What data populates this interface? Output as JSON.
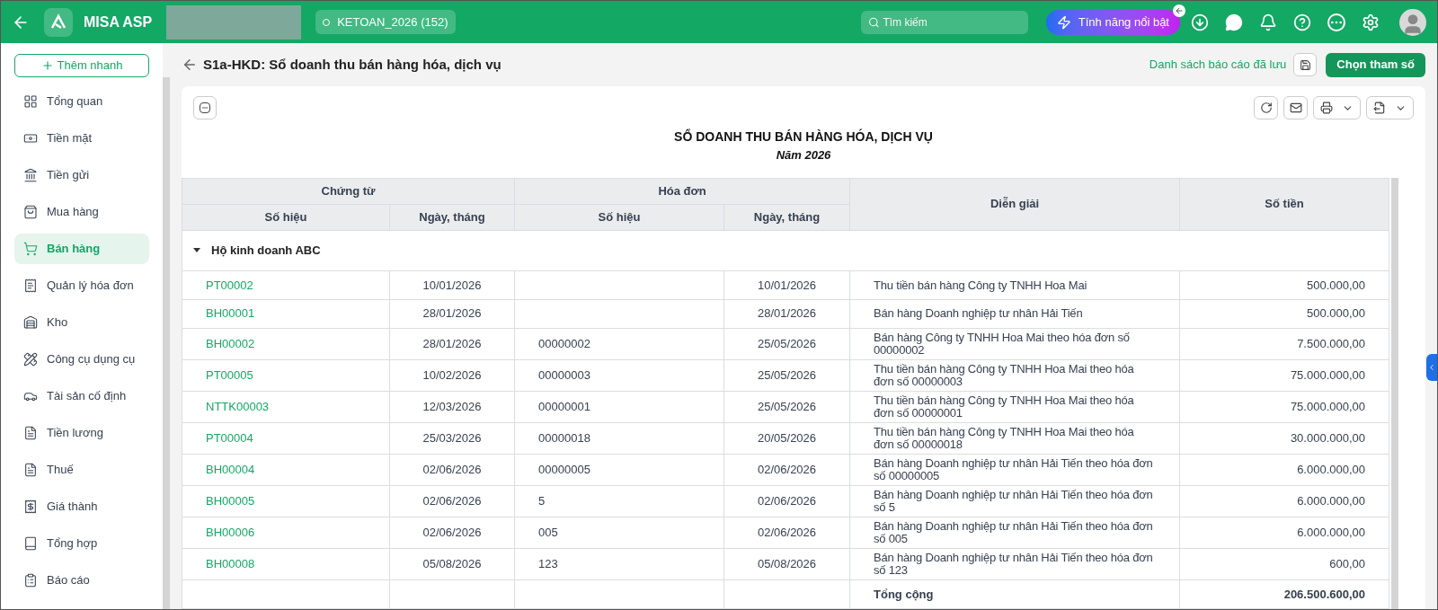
{
  "header": {
    "app_name": "MISA ASP",
    "database": "KETOAN_2026 (152)",
    "search": {
      "placeholder": "Tìm kiếm"
    },
    "featured_button": "Tính năng nổi bật"
  },
  "sidebar": {
    "quick_add": "Thêm nhanh",
    "items": [
      {
        "label": "Tổng quan",
        "selected": false
      },
      {
        "label": "Tiền mặt",
        "selected": false
      },
      {
        "label": "Tiền gửi",
        "selected": false
      },
      {
        "label": "Mua hàng",
        "selected": false
      },
      {
        "label": "Bán hàng",
        "selected": true
      },
      {
        "label": "Quản lý hóa đơn",
        "selected": false
      },
      {
        "label": "Kho",
        "selected": false
      },
      {
        "label": "Công cụ dụng cụ",
        "selected": false
      },
      {
        "label": "Tài sản cố định",
        "selected": false
      },
      {
        "label": "Tiền lương",
        "selected": false
      },
      {
        "label": "Thuế",
        "selected": false
      },
      {
        "label": "Giá thành",
        "selected": false
      },
      {
        "label": "Tổng hợp",
        "selected": false
      },
      {
        "label": "Báo cáo",
        "selected": false
      }
    ]
  },
  "page": {
    "title": "S1a-HKD: Sổ doanh thu bán hàng hóa, dịch vụ",
    "saved_reports_link": "Danh sách báo cáo đã lưu",
    "choose_params_button": "Chọn tham số"
  },
  "report": {
    "title": "SỔ DOANH THU BÁN HÀNG HÓA, DỊCH VỤ",
    "subtitle": "Năm 2026",
    "column_groups": [
      "Chứng từ",
      "Hóa đơn",
      "Diễn giải",
      "Số tiền"
    ],
    "columns": [
      "Số hiệu",
      "Ngày, tháng",
      "Số hiệu",
      "Ngày, tháng"
    ],
    "group": {
      "label": "Hộ kinh doanh ABC",
      "expanded": true
    },
    "rows": [
      {
        "voucher_no": "PT00002",
        "voucher_date": "10/01/2026",
        "invoice_date": "10/01/2026",
        "description": "Thu tiền bán hàng Công ty TNHH Hoa Mai",
        "amount": "500.000,00"
      },
      {
        "voucher_no": "BH00001",
        "voucher_date": "28/01/2026",
        "invoice_date": "28/01/2026",
        "description": "Bán hàng Doanh nghiệp tư nhân Hải Tiến",
        "amount": "500.000,00"
      },
      {
        "voucher_no": "BH00002",
        "voucher_date": "28/01/2026",
        "invoice_no": "00000002",
        "invoice_date": "25/05/2026",
        "description": "Bán hàng Công ty TNHH Hoa Mai theo hóa đơn số 00000002",
        "amount": "7.500.000,00"
      },
      {
        "voucher_no": "PT00005",
        "voucher_date": "10/02/2026",
        "invoice_no": "00000003",
        "invoice_date": "25/05/2026",
        "description": "Thu tiền bán hàng Công ty TNHH Hoa Mai theo hóa đơn số 00000003",
        "amount": "75.000.000,00"
      },
      {
        "voucher_no": "NTTK00003",
        "voucher_date": "12/03/2026",
        "invoice_no": "00000001",
        "invoice_date": "25/05/2026",
        "description": "Thu tiền bán hàng Công ty TNHH Hoa Mai theo hóa đơn số 00000001",
        "amount": "75.000.000,00"
      },
      {
        "voucher_no": "PT00004",
        "voucher_date": "25/03/2026",
        "invoice_no": "00000018",
        "invoice_date": "20/05/2026",
        "description": "Thu tiền bán hàng Công ty TNHH Hoa Mai theo hóa đơn số 00000018",
        "amount": "30.000.000,00"
      },
      {
        "voucher_no": "BH00004",
        "voucher_date": "02/06/2026",
        "invoice_no": "00000005",
        "invoice_date": "02/06/2026",
        "description": "Bán hàng Doanh nghiệp tư nhân Hải Tiến theo hóa đơn số 00000005",
        "amount": "6.000.000,00"
      },
      {
        "voucher_no": "BH00005",
        "voucher_date": "02/06/2026",
        "invoice_no": "5",
        "invoice_date": "02/06/2026",
        "description": "Bán hàng Doanh nghiệp tư nhân Hải Tiến theo hóa đơn số 5",
        "amount": "6.000.000,00"
      },
      {
        "voucher_no": "BH00006",
        "voucher_date": "02/06/2026",
        "invoice_no": "005",
        "invoice_date": "02/06/2026",
        "description": "Bán hàng Doanh nghiệp tư nhân Hải Tiến theo hóa đơn số 005",
        "amount": "6.000.000,00"
      },
      {
        "voucher_no": "BH00008",
        "voucher_date": "05/08/2026",
        "invoice_no": "123",
        "invoice_date": "05/08/2026",
        "description": "Bán hàng Doanh nghiệp tư nhân Hải Tiến theo hóa đơn số 123",
        "amount": "600,00"
      }
    ],
    "total": {
      "label": "Tổng cộng",
      "amount": "206.500.600,00"
    }
  }
}
